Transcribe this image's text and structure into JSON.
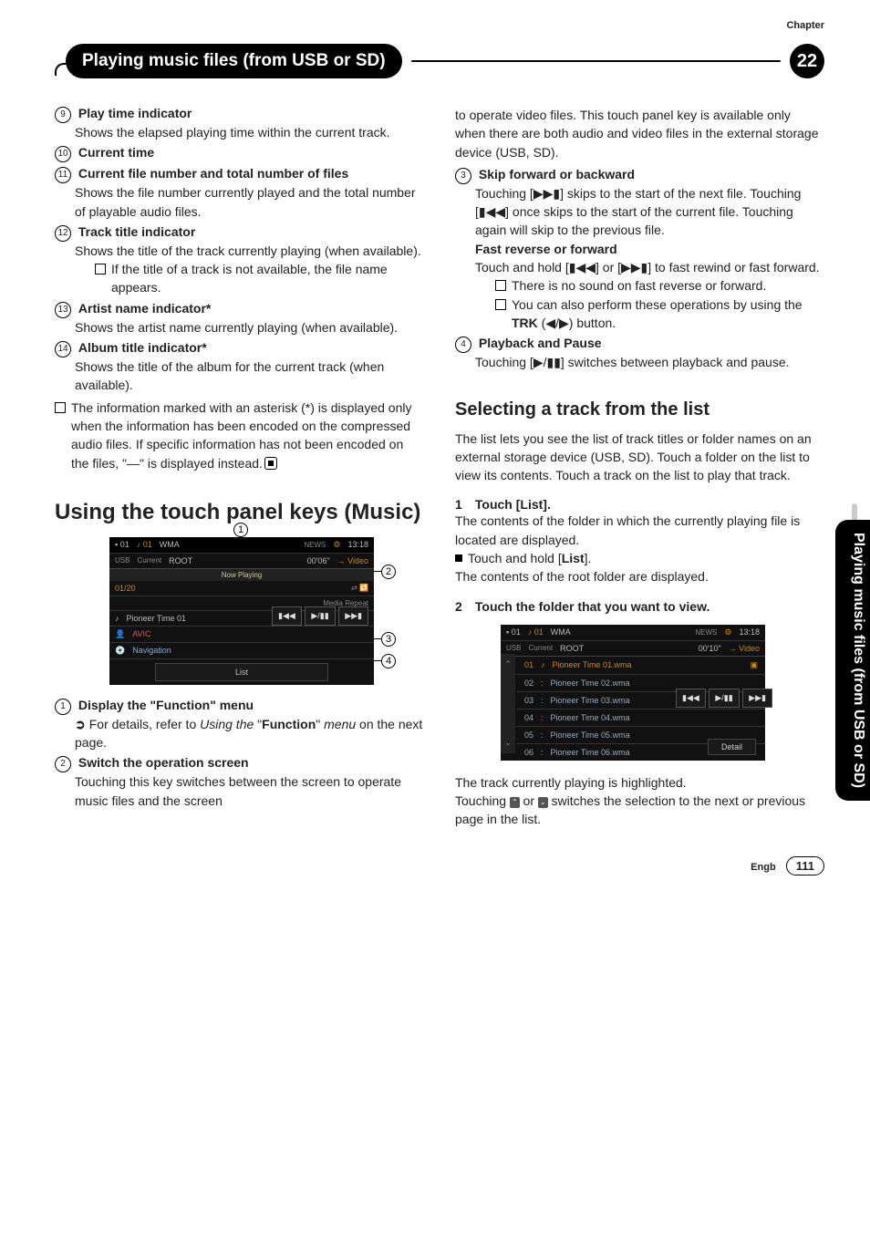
{
  "chapter_label": "Chapter",
  "chapter_num": "22",
  "header_title": "Playing music files (from USB or SD)",
  "side_tab": "Playing music files (from USB or SD)",
  "left": {
    "i9": {
      "num": "9",
      "title": "Play time indicator",
      "desc": "Shows the elapsed playing time within the current track."
    },
    "i10": {
      "num": "10",
      "title": "Current time"
    },
    "i11": {
      "num": "11",
      "title": "Current file number and total number of files",
      "desc": "Shows the file number currently played and the total number of playable audio files."
    },
    "i12": {
      "num": "12",
      "title": "Track title indicator",
      "desc": "Shows the title of the track currently playing (when available).",
      "sub": "If the title of a track is not available, the file name appears."
    },
    "i13": {
      "num": "13",
      "title": "Artist name indicator*",
      "desc": "Shows the artist name currently playing (when available)."
    },
    "i14": {
      "num": "14",
      "title": "Album title indicator*",
      "desc": "Shows the title of the album for the current track (when available)."
    },
    "note": "The information marked with an asterisk (*) is displayed only when the information has been encoded on the compressed audio files. If specific information has not been encoded on the files, \"—\" is displayed instead.",
    "section": "Using the touch panel keys (Music)",
    "b1": {
      "num": "1",
      "title": "Display the \"Function\" menu",
      "desc_pre": "For details, refer to ",
      "desc_it1": "Using the ",
      "desc_q": "\"",
      "desc_b": "Function",
      "desc_q2": "\" ",
      "desc_it2": "menu",
      "desc_post": " on the next page."
    },
    "b2": {
      "num": "2",
      "title": "Switch the operation screen",
      "desc": "Touching this key switches between the screen to operate music files and the screen"
    }
  },
  "right": {
    "cont": "to operate video files. This touch panel key is available only when there are both audio and video files in the external storage device (USB, SD).",
    "i3": {
      "num": "3",
      "title": "Skip forward or backward",
      "d1a": "Touching [",
      "d1b": "] skips to the start of the next file. Touching [",
      "d1c": "] once skips to the start of the current file. Touching again will skip to the previous file.",
      "sub_title": "Fast reverse or forward",
      "d2a": "Touch and hold [",
      "d2b": "] or [",
      "d2c": "] to fast rewind or fast forward.",
      "s1": "There is no sound on fast reverse or forward.",
      "s2a": "You can also perform these operations by using the ",
      "s2trk": "TRK",
      "s2b": " (",
      "s2c": "/",
      "s2d": ") button."
    },
    "i4": {
      "num": "4",
      "title": "Playback and Pause",
      "d1a": "Touching [",
      "d1b": "] switches between playback and pause."
    },
    "sub_heading": "Selecting a track from the list",
    "sub_desc": "The list lets you see the list of track titles or folder names on an external storage device (USB, SD). Touch a folder on the list to view its contents. Touch a track on the list to play that track.",
    "step1": {
      "n": "1",
      "t": "Touch [List].",
      "d": "The contents of the folder in which the currently playing file is located are displayed.",
      "bp_a": "Touch and hold [",
      "bp_b": "List",
      "bp_c": "].",
      "d2": "The contents of the root folder are displayed."
    },
    "step2": {
      "n": "2",
      "t": "Touch the folder that you want to view."
    },
    "tail1": "The track currently playing is highlighted.",
    "tail2a": "Touching ",
    "tail2b": " or ",
    "tail2c": " switches the selection to the next or previous page in the list."
  },
  "shot1": {
    "usb": "USB",
    "current": "Current",
    "root": "ROOT",
    "tl": "01",
    "tr": "01",
    "wma": "WMA",
    "news": "NEWS",
    "time": "13:18",
    "elapsed": "00'06\"",
    "video": "→ Video",
    "np": "Now Playing",
    "count": "01/20",
    "mr": "Media Repeat",
    "r1": "Pioneer Time 01",
    "r2": "AVIC",
    "r3": "Navigation",
    "c_prev": "▮◀◀",
    "c_play": "▶/▮▮",
    "c_next": "▶▶▮",
    "list": "List",
    "co1": "1",
    "co2": "2",
    "co3": "3",
    "co4": "4"
  },
  "shot2": {
    "usb": "USB",
    "current": "Current",
    "root": "ROOT",
    "tl": "01",
    "tr": "01",
    "wma": "WMA",
    "news": "NEWS",
    "time": "13:18",
    "elapsed": "00'10\"",
    "video": "→ Video",
    "t1n": "01",
    "t1": "Pioneer Time 01.wma",
    "t2n": "02",
    "t2": "Pioneer Time 02.wma",
    "t3n": "03",
    "t3": "Pioneer Time 03.wma",
    "t4n": "04",
    "t4": "Pioneer Time 04.wma",
    "t5n": "05",
    "t5": "Pioneer Time 05.wma",
    "t6n": "06",
    "t6": "Pioneer Time 06.wma",
    "c_prev": "▮◀◀",
    "c_play": "▶/▮▮",
    "c_next": "▶▶▮",
    "detail": "Detail",
    "up": "⌃",
    "down": "⌄"
  },
  "footer": {
    "lang": "Engb",
    "page": "111"
  }
}
